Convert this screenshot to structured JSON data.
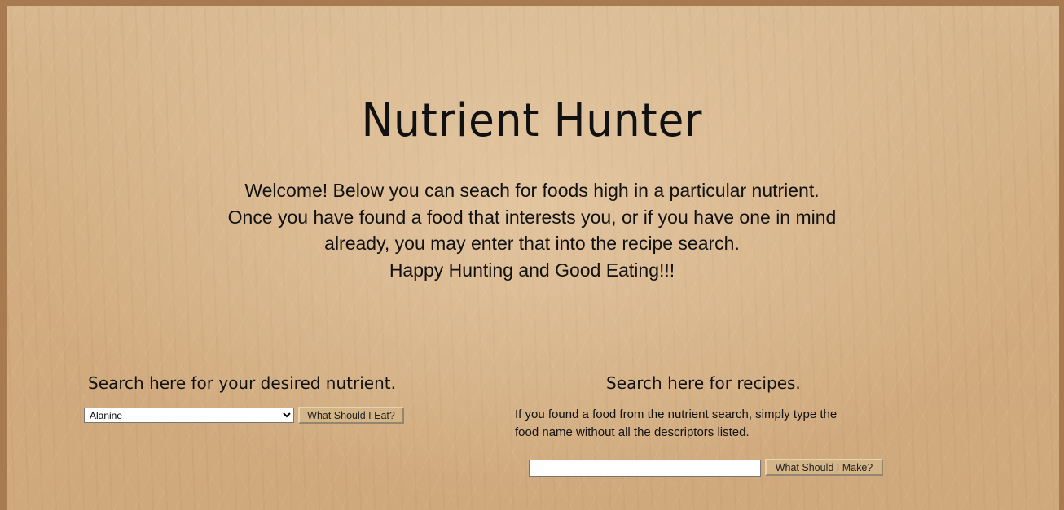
{
  "header": {
    "title": "Nutrient Hunter"
  },
  "intro": {
    "lines": [
      "Welcome! Below you can seach for foods high in a particular nutrient.",
      "Once you have found a food that interests you, or if you have one in mind",
      "already, you may enter that into the recipe search.",
      "Happy Hunting and Good Eating!!!"
    ]
  },
  "nutrient_search": {
    "heading": "Search here for your desired nutrient.",
    "selected_option": "Alanine",
    "button_label": "What Should I Eat?"
  },
  "recipe_search": {
    "heading": "Search here for recipes.",
    "help_lines": [
      "If you found a food from the nutrient search, simply type the",
      "food name without all the descriptors listed."
    ],
    "input_value": "",
    "button_label": "What Should I Make?"
  },
  "colors": {
    "background": "#d3ae82",
    "frame": "#a87a4f",
    "button": "#d3b587",
    "text": "#111111"
  }
}
